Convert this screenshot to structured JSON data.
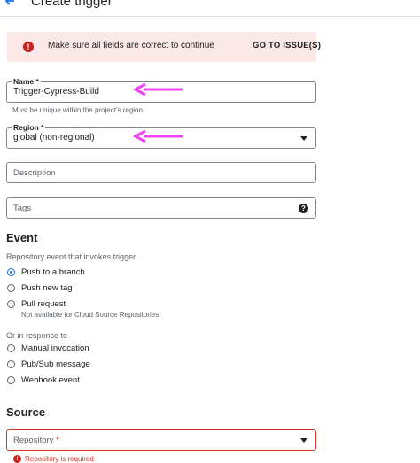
{
  "header": {
    "title": "Create trigger",
    "back_icon": "arrow-back-icon"
  },
  "banner": {
    "icon": "error-icon",
    "message": "Make sure all fields are correct to continue",
    "action_label": "GO TO ISSUE(S)",
    "background_color": "#fce8e6"
  },
  "form": {
    "name": {
      "label": "Name *",
      "value": "Trigger-Cypress-Build",
      "hint": "Must be unique within the project's region"
    },
    "region": {
      "label": "Region *",
      "value": "global (non-regional)"
    },
    "description": {
      "placeholder": "Description"
    },
    "tags": {
      "placeholder": "Tags",
      "help_icon": "help-icon"
    }
  },
  "annotation": {
    "arrow_color": "#ee44ee"
  },
  "event": {
    "title": "Event",
    "repo_label": "Repository event that invokes trigger",
    "repo_options": [
      {
        "label": "Push to a branch",
        "checked": true
      },
      {
        "label": "Push new tag",
        "checked": false
      },
      {
        "label": "Pull request",
        "checked": false,
        "sublabel": "Not available for Cloud Source Repositories"
      }
    ],
    "other_label": "Or in response to",
    "other_options": [
      {
        "label": "Manual invocation",
        "checked": false
      },
      {
        "label": "Pub/Sub message",
        "checked": false
      },
      {
        "label": "Webhook event",
        "checked": false
      }
    ]
  },
  "source": {
    "title": "Source",
    "repository": {
      "placeholder": "Repository",
      "required_mark": "*",
      "error": "Repository is required"
    }
  },
  "colors": {
    "accent": "#1a73e8",
    "error": "#d93025"
  }
}
